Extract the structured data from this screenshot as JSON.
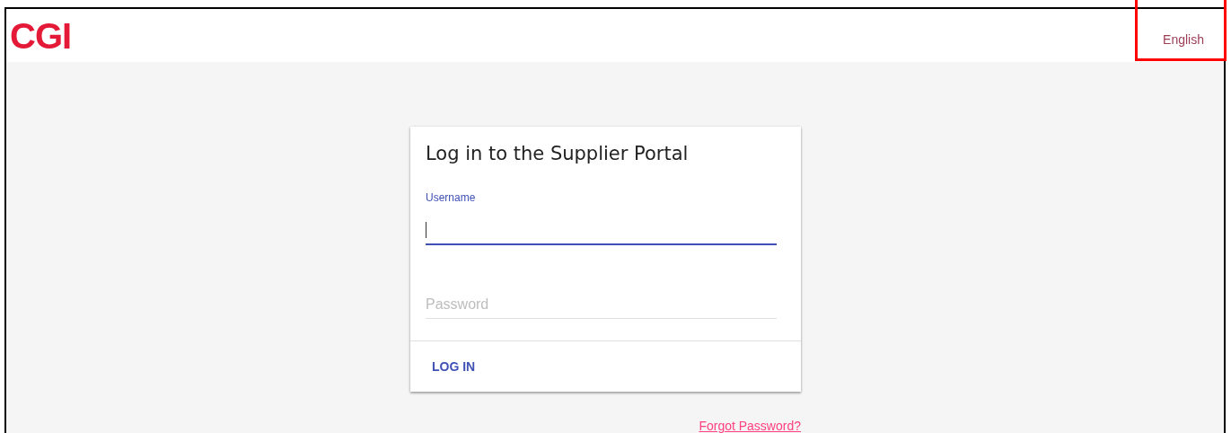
{
  "header": {
    "logo": "CGI",
    "language": "English"
  },
  "annotation": {
    "kind": "highlight",
    "color": "#ff0000"
  },
  "login_card": {
    "title": "Log in to the Supplier Portal",
    "fields": [
      {
        "label": "Username",
        "focused": true
      },
      {
        "placeholder": "Password",
        "focused": false
      }
    ],
    "button": "LOG IN"
  },
  "forgot_link": "Forgot Password?"
}
